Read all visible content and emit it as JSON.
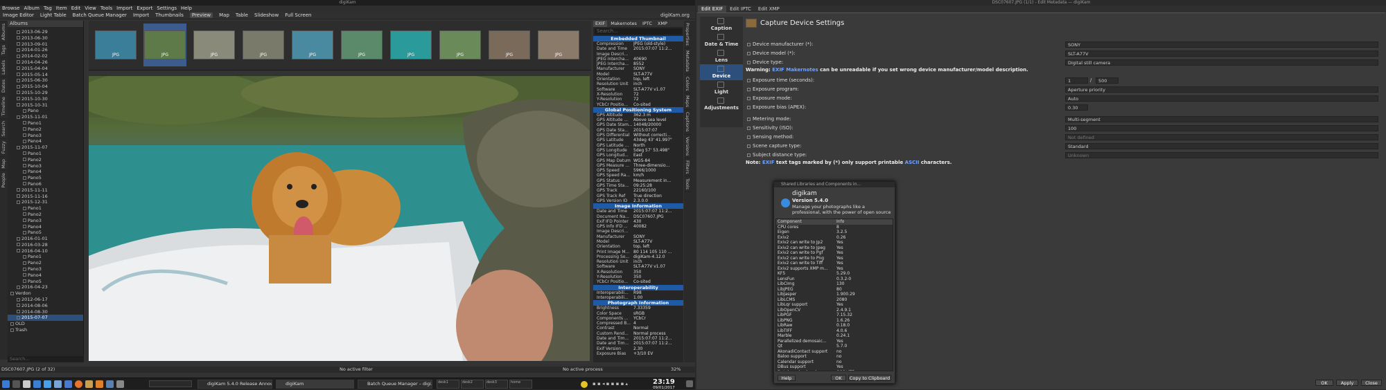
{
  "left_window": {
    "title": "digiKam",
    "menu": [
      "Browse",
      "Album",
      "Tag",
      "Item",
      "Edit",
      "View",
      "Tools",
      "Import",
      "Export",
      "Settings",
      "Help"
    ],
    "toolbar": [
      "Image Editor",
      "Light Table",
      "Batch Queue Manager",
      "Import",
      "Thumbnails",
      "Preview",
      "Map",
      "Table",
      "Slideshow",
      "Full Screen"
    ],
    "toolbar_active": "Preview",
    "brand": "digiKam.org",
    "side_tabs_left": [
      "Albums",
      "Tags",
      "Labels",
      "Dates",
      "Timeline",
      "Search",
      "Fuzzy",
      "Map",
      "People"
    ],
    "albums_header": "Albums",
    "albums": [
      {
        "label": "2013-06-29",
        "depth": 1,
        "sel": false
      },
      {
        "label": "2013-06-30",
        "depth": 1,
        "sel": false
      },
      {
        "label": "2013-09-01",
        "depth": 1,
        "sel": false
      },
      {
        "label": "2014-01-26",
        "depth": 1,
        "sel": false
      },
      {
        "label": "2014-02-02",
        "depth": 1,
        "sel": false
      },
      {
        "label": "2014-04-26",
        "depth": 1,
        "sel": false
      },
      {
        "label": "2015-04-04",
        "depth": 1,
        "sel": false
      },
      {
        "label": "2015-05-14",
        "depth": 1,
        "sel": false
      },
      {
        "label": "2015-06-30",
        "depth": 1,
        "sel": false
      },
      {
        "label": "2015-10-04",
        "depth": 1,
        "sel": false
      },
      {
        "label": "2015-10-29",
        "depth": 1,
        "sel": false
      },
      {
        "label": "2015-10-30",
        "depth": 1,
        "sel": false
      },
      {
        "label": "2015-10-31",
        "depth": 1,
        "sel": false
      },
      {
        "label": "Pano",
        "depth": 2,
        "sel": false
      },
      {
        "label": "2015-11-01",
        "depth": 1,
        "sel": false
      },
      {
        "label": "Pano1",
        "depth": 2,
        "sel": false
      },
      {
        "label": "Pano2",
        "depth": 2,
        "sel": false
      },
      {
        "label": "Pano3",
        "depth": 2,
        "sel": false
      },
      {
        "label": "Pano4",
        "depth": 2,
        "sel": false
      },
      {
        "label": "2015-11-07",
        "depth": 1,
        "sel": false
      },
      {
        "label": "Pano1",
        "depth": 2,
        "sel": false
      },
      {
        "label": "Pano2",
        "depth": 2,
        "sel": false
      },
      {
        "label": "Pano3",
        "depth": 2,
        "sel": false
      },
      {
        "label": "Pano4",
        "depth": 2,
        "sel": false
      },
      {
        "label": "Pano5",
        "depth": 2,
        "sel": false
      },
      {
        "label": "Pano6",
        "depth": 2,
        "sel": false
      },
      {
        "label": "2015-11-11",
        "depth": 1,
        "sel": false
      },
      {
        "label": "2015-11-16",
        "depth": 1,
        "sel": false
      },
      {
        "label": "2015-12-31",
        "depth": 1,
        "sel": false
      },
      {
        "label": "Pano1",
        "depth": 2,
        "sel": false
      },
      {
        "label": "Pano2",
        "depth": 2,
        "sel": false
      },
      {
        "label": "Pano3",
        "depth": 2,
        "sel": false
      },
      {
        "label": "Pano4",
        "depth": 2,
        "sel": false
      },
      {
        "label": "Pano5",
        "depth": 2,
        "sel": false
      },
      {
        "label": "2016-01-01",
        "depth": 1,
        "sel": false
      },
      {
        "label": "2016-03-28",
        "depth": 1,
        "sel": false
      },
      {
        "label": "2016-04-10",
        "depth": 1,
        "sel": false
      },
      {
        "label": "Pano1",
        "depth": 2,
        "sel": false
      },
      {
        "label": "Pano2",
        "depth": 2,
        "sel": false
      },
      {
        "label": "Pano3",
        "depth": 2,
        "sel": false
      },
      {
        "label": "Pano4",
        "depth": 2,
        "sel": false
      },
      {
        "label": "Pano5",
        "depth": 2,
        "sel": false
      },
      {
        "label": "2016-04-23",
        "depth": 1,
        "sel": false
      },
      {
        "label": "Verdon",
        "depth": 0,
        "sel": false
      },
      {
        "label": "2012-06-17",
        "depth": 1,
        "sel": false
      },
      {
        "label": "2014-08-06",
        "depth": 1,
        "sel": false
      },
      {
        "label": "2014-08-30",
        "depth": 1,
        "sel": false
      },
      {
        "label": "2015-07-07",
        "depth": 1,
        "sel": true
      },
      {
        "label": "OLD",
        "depth": 0,
        "sel": false
      },
      {
        "label": "Trash",
        "depth": 0,
        "sel": false
      }
    ],
    "albums_search_placeholder": "Search...",
    "thumbnails": [
      {
        "label": "JPG",
        "sel": false,
        "bg": "#3a7e9a"
      },
      {
        "label": "JPG",
        "sel": true,
        "bg": "#5e7a48"
      },
      {
        "label": "JPG",
        "sel": false,
        "bg": "#8a8a7a"
      },
      {
        "label": "JPG",
        "sel": false,
        "bg": "#7a7a6a"
      },
      {
        "label": "JPG",
        "sel": false,
        "bg": "#4a8aa0"
      },
      {
        "label": "JPG",
        "sel": false,
        "bg": "#5a8a6a"
      },
      {
        "label": "JPG",
        "sel": false,
        "bg": "#2a9a9a"
      },
      {
        "label": "JPG",
        "sel": false,
        "bg": "#6a8a5a"
      },
      {
        "label": "JPG",
        "sel": false,
        "bg": "#7a6a5a"
      },
      {
        "label": "JPG",
        "sel": false,
        "bg": "#8a7a6a"
      }
    ],
    "meta_tabs": [
      "EXIF",
      "Makernotes",
      "IPTC",
      "XMP"
    ],
    "meta_search_placeholder": "Search...",
    "metadata": [
      {
        "section": "Embedded Thumbnail"
      },
      {
        "k": "Compression",
        "v": "JPEG (old-style)"
      },
      {
        "k": "Date and Time",
        "v": "2015:07:07 11:2..."
      },
      {
        "k": "Image Descri...",
        "v": ""
      },
      {
        "k": "JPEG Intercha...",
        "v": "40690"
      },
      {
        "k": "JPEG Intercha...",
        "v": "8552"
      },
      {
        "k": "Manufacturer",
        "v": "SONY"
      },
      {
        "k": "Model",
        "v": "SLT-A77V"
      },
      {
        "k": "Orientation",
        "v": "top, left"
      },
      {
        "k": "Resolution Unit",
        "v": "inch"
      },
      {
        "k": "Software",
        "v": "SLT-A77V v1.07"
      },
      {
        "k": "X-Resolution",
        "v": "72"
      },
      {
        "k": "Y-Resolution",
        "v": "72"
      },
      {
        "k": "YCbCr Positio...",
        "v": "Co-sited"
      },
      {
        "section": "Global Positioning System"
      },
      {
        "k": "GPS Altitude",
        "v": "362.3 m"
      },
      {
        "k": "GPS Altitude ...",
        "v": "Above sea level"
      },
      {
        "k": "GPS Date Stam...",
        "v": "14048/20000"
      },
      {
        "k": "GPS Date Sta...",
        "v": "2015:07:07"
      },
      {
        "k": "GPS Differential",
        "v": "Without correcti..."
      },
      {
        "k": "GPS Latitude",
        "v": "43deg 43' 41.997\""
      },
      {
        "k": "GPS Latitude ...",
        "v": "North"
      },
      {
        "k": "GPS Longitude",
        "v": "5deg 57' 53.498\""
      },
      {
        "k": "GPS Longitud...",
        "v": "East"
      },
      {
        "k": "GPS Map Datum",
        "v": "WGS-84"
      },
      {
        "k": "GPS Measure ...",
        "v": "Three-dimensio..."
      },
      {
        "k": "GPS Speed",
        "v": "5966/1000"
      },
      {
        "k": "GPS Speed Ra...",
        "v": "km/h"
      },
      {
        "k": "GPS Status",
        "v": "Measurement in..."
      },
      {
        "k": "GPS Time Sta...",
        "v": "09:25:28"
      },
      {
        "k": "GPS Track",
        "v": "22160/100"
      },
      {
        "k": "GPS Track Ref",
        "v": "True direction"
      },
      {
        "k": "GPS Version ID",
        "v": "2.3.0.0"
      },
      {
        "section": "Image Information"
      },
      {
        "k": "Date and Time",
        "v": "2015:07:07 11:2..."
      },
      {
        "k": "Document Na...",
        "v": "DSC07607.JPG"
      },
      {
        "k": "Exif IFD Pointer",
        "v": "430"
      },
      {
        "k": "GPS Info IFD ...",
        "v": "40082"
      },
      {
        "k": "Image Descri...",
        "v": ""
      },
      {
        "k": "Manufacturer",
        "v": "SONY"
      },
      {
        "k": "Model",
        "v": "SLT-A77V"
      },
      {
        "k": "Orientation",
        "v": "top, left"
      },
      {
        "k": "Print Image M...",
        "v": "80 114 105 110 ..."
      },
      {
        "k": "Processing So...",
        "v": "digiKam-4.12.0"
      },
      {
        "k": "Resolution Unit",
        "v": "inch"
      },
      {
        "k": "Software",
        "v": "SLT-A77V v1.07"
      },
      {
        "k": "X-Resolution",
        "v": "350"
      },
      {
        "k": "Y-Resolution",
        "v": "350"
      },
      {
        "k": "YCbCr Positio...",
        "v": "Co-sited"
      },
      {
        "section": "Interoperability"
      },
      {
        "k": "Interoperabili...",
        "v": "R98"
      },
      {
        "k": "Interoperabili...",
        "v": "1.00"
      },
      {
        "section": "Photograph Information"
      },
      {
        "k": "Brightness",
        "v": "7.33359"
      },
      {
        "k": "Color Space",
        "v": "sRGB"
      },
      {
        "k": "Components ...",
        "v": "YCbCr"
      },
      {
        "k": "Compressed B...",
        "v": "4"
      },
      {
        "k": "Contrast",
        "v": "Normal"
      },
      {
        "k": "Custom Rend...",
        "v": "Normal process"
      },
      {
        "k": "Date and Tim...",
        "v": "2015:07:07 11:2..."
      },
      {
        "k": "Date and Tim...",
        "v": "2015:07:07 11:2..."
      },
      {
        "k": "Exif Version",
        "v": "2.30"
      },
      {
        "k": "Exposure Bias",
        "v": "+3/10 EV"
      }
    ],
    "right_side_tabs": [
      "Properties",
      "Metadata",
      "Colors",
      "Maps",
      "Captions",
      "Versions",
      "Filters",
      "Tools"
    ],
    "status_file": "DSC07607.JPG (2 of 32)",
    "status_filter": "No active filter",
    "status_process": "No active process",
    "status_zoom": "32%",
    "taskbar_tasks": [
      "digiKam 5.4.0 Release Announ...",
      "digiKam",
      "Batch Queue Manager – digi..."
    ],
    "taskbar_active": "digiKam",
    "clock_time": "23:19",
    "clock_date": "09/01/2017",
    "pager": [
      "desk1",
      "desk2",
      "desk3",
      "home"
    ]
  },
  "right_window": {
    "title": "DSC07607.JPG (1/1) - Edit Metadata — digiKam",
    "tabs": [
      "Edit EXIF",
      "Edit IPTC",
      "Edit XMP"
    ],
    "active_tab": "Edit EXIF",
    "categories": [
      "Caption",
      "Date & Time",
      "Lens",
      "Device",
      "Light",
      "Adjustments"
    ],
    "active_category": "Device",
    "heading": "Capture Device Settings",
    "rows": [
      {
        "label": "Device manufacturer (*):",
        "value": "SONY",
        "disabled": false
      },
      {
        "label": "Device model (*):",
        "value": "SLT-A77V",
        "disabled": false
      },
      {
        "label": "Device type:",
        "value": "Digital still camera",
        "disabled": false
      }
    ],
    "warning_prefix": "Warning: ",
    "warning_exif": "EXIF",
    "warning_link": "Makernotes",
    "warning_rest": " can be unreadable if you set wrong device manufacturer/model description.",
    "exposure_time_label": "Exposure time (seconds):",
    "exposure_num": "1",
    "exposure_den": "500",
    "exposure_program_label": "Exposure program:",
    "exposure_program_value": "Aperture priority",
    "exposure_mode_label": "Exposure mode:",
    "exposure_mode_value": "Auto",
    "exposure_bias_label": "Exposure bias (APEX):",
    "exposure_bias_value": "0.30",
    "metering_label": "Metering mode:",
    "metering_value": "Multi-segment",
    "iso_label": "Sensitivity (ISO):",
    "iso_value": "100",
    "sensing_label": "Sensing method:",
    "sensing_value": "Not defined",
    "scene_label": "Scene capture type:",
    "scene_value": "Standard",
    "subject_label": "Subject distance type:",
    "subject_value": "Unknown",
    "note_prefix": "Note: ",
    "note_exif": "EXIF",
    "note_mid": " text tags marked by (*) only support printable ",
    "note_ascii": "ASCII",
    "note_end": " characters.",
    "buttons": [
      "OK",
      "Apply",
      "Close"
    ]
  },
  "about": {
    "title": "Shared Libraries and Components in...",
    "app": "digikam",
    "version": "Version 5.4.0",
    "tagline": "Manage your photographs like a professional, with the power of open source",
    "col_component": "Component",
    "col_info": "Info",
    "components": [
      [
        "CPU cores",
        "8"
      ],
      [
        "Eigen",
        "3.2.5"
      ],
      [
        "Exiv2",
        "0.26"
      ],
      [
        "Exiv2 can write to Jp2",
        "Yes"
      ],
      [
        "Exiv2 can write to Jpeg",
        "Yes"
      ],
      [
        "Exiv2 can write to Pgf",
        "Yes"
      ],
      [
        "Exiv2 can write to Png",
        "Yes"
      ],
      [
        "Exiv2 can write to Tiff",
        "Yes"
      ],
      [
        "Exiv2 supports XMP m...",
        "Yes"
      ],
      [
        "KF5",
        "5.29.0"
      ],
      [
        "LensFun",
        "0.3.2-0"
      ],
      [
        "LibCImg",
        "130"
      ],
      [
        "LibJPEG",
        "80"
      ],
      [
        "LibJasper",
        "1.900.29"
      ],
      [
        "LibLCMS",
        "2080"
      ],
      [
        "LibLqr support",
        "Yes"
      ],
      [
        "LibOpenCV",
        "2.4.9.1"
      ],
      [
        "LibPGF",
        "7.15.32"
      ],
      [
        "LibPNG",
        "1.6.26"
      ],
      [
        "LibRaw",
        "0.18.0"
      ],
      [
        "LibTIFF",
        "4.0.6"
      ],
      [
        "Marble",
        "0.24.1"
      ],
      [
        "Parallelized demosaic...",
        "Yes"
      ],
      [
        "Qt",
        "5.7.0"
      ],
      [
        "AkonadiContact support",
        "no"
      ],
      [
        "Baloo support",
        "no"
      ],
      [
        "Calendar support",
        "no"
      ],
      [
        "DBus support",
        "Yes"
      ],
      [
        "Database backend",
        "QSQLITE"
      ],
      [
        "Kipi-Plugins",
        "5.4.0"
      ]
    ],
    "help_label": "Help",
    "ok_label": "OK",
    "copy_label": "Copy to Clipboard"
  }
}
